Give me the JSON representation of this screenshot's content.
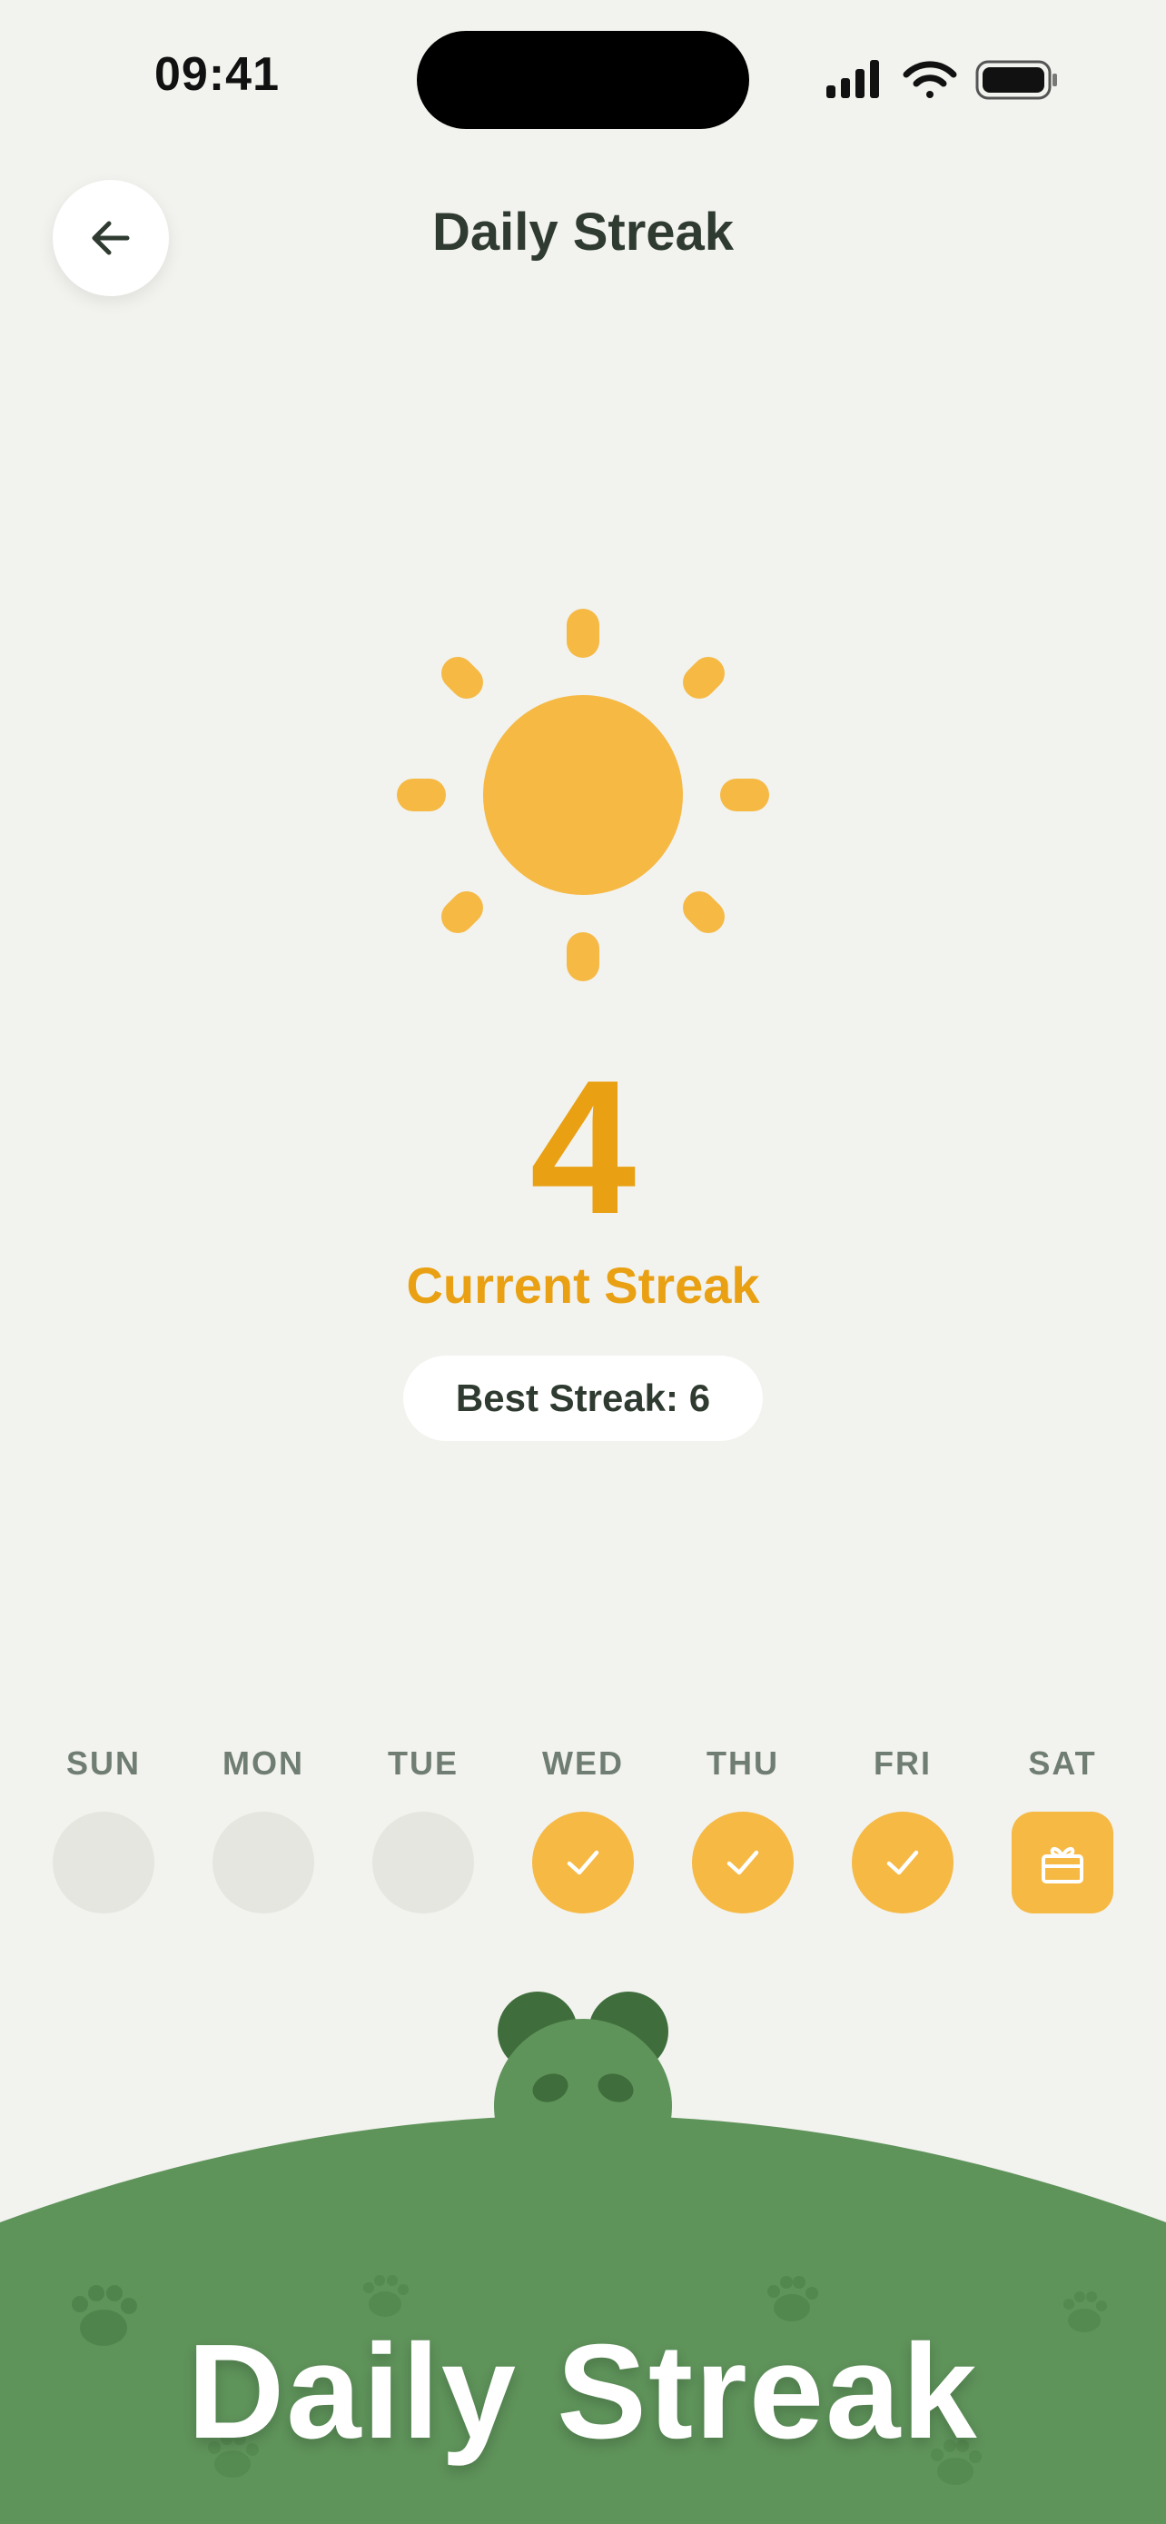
{
  "status_bar": {
    "time": "09:41"
  },
  "header": {
    "title": "Daily Streak",
    "back_icon": "arrow-left-icon"
  },
  "streak": {
    "current": "4",
    "current_label": "Current Streak",
    "best_label": "Best Streak: 6",
    "icon": "sun-icon"
  },
  "week": [
    {
      "label": "SUN",
      "state": "empty"
    },
    {
      "label": "MON",
      "state": "empty"
    },
    {
      "label": "TUE",
      "state": "empty"
    },
    {
      "label": "WED",
      "state": "done"
    },
    {
      "label": "THU",
      "state": "done"
    },
    {
      "label": "FRI",
      "state": "done"
    },
    {
      "label": "SAT",
      "state": "gift"
    }
  ],
  "banner": {
    "title": "Daily Streak"
  },
  "colors": {
    "background": "#f2f2ee",
    "accent": "#e9a012",
    "sun": "#f5b944",
    "hill": "#5e935a",
    "text_dark": "#2f3b30"
  }
}
